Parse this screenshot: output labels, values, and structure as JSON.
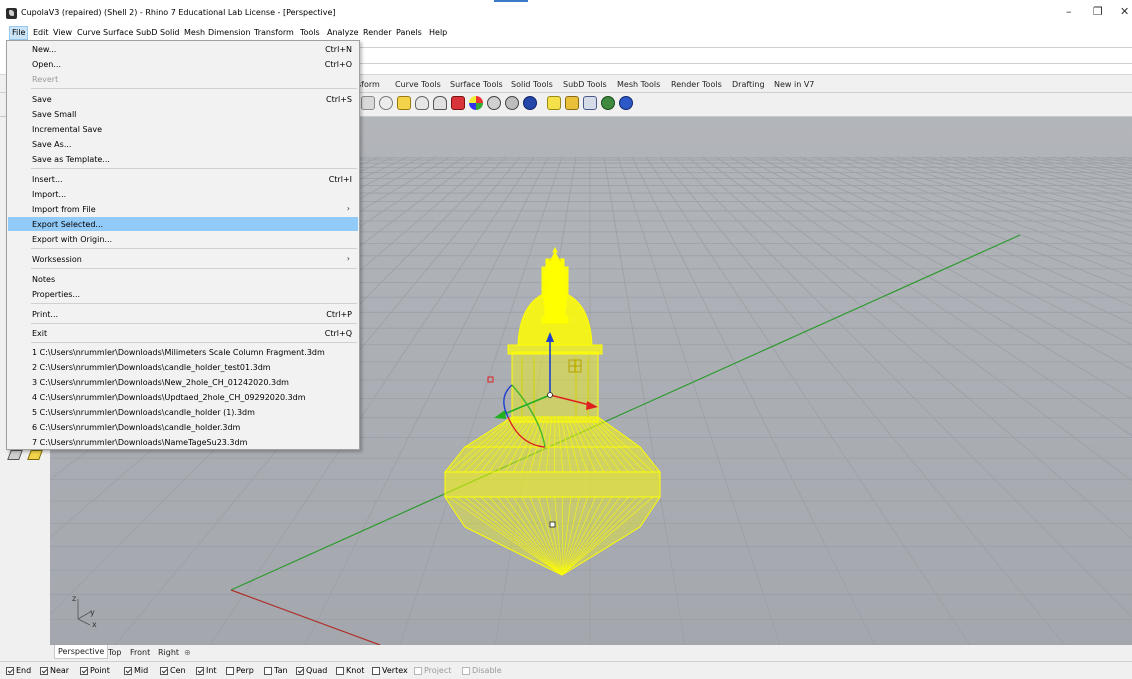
{
  "window": {
    "title": "CupolaV3 (repaired) (Shell 2) - Rhino 7 Educational Lab License - [Perspective]",
    "controls": {
      "minimize": "–",
      "restore": "❐",
      "close": "✕"
    }
  },
  "menubar": {
    "items": [
      "File",
      "Edit",
      "View",
      "Curve",
      "Surface",
      "SubD",
      "Solid",
      "Mesh",
      "Dimension",
      "Transform",
      "Tools",
      "Analyze",
      "Render",
      "Panels",
      "Help"
    ],
    "active": "File"
  },
  "toolbar_tabs": [
    "sform",
    "Curve Tools",
    "Surface Tools",
    "Solid Tools",
    "SubD Tools",
    "Mesh Tools",
    "Render Tools",
    "Drafting",
    "New in V7"
  ],
  "file_menu": {
    "items": [
      {
        "label": "New...",
        "shortcut": "Ctrl+N"
      },
      {
        "label": "Open...",
        "shortcut": "Ctrl+O"
      },
      {
        "label": "Revert",
        "shortcut": "",
        "disabled": true
      },
      {
        "label": "Save",
        "shortcut": "Ctrl+S"
      },
      {
        "label": "Save Small",
        "shortcut": ""
      },
      {
        "label": "Incremental Save",
        "shortcut": ""
      },
      {
        "label": "Save As...",
        "shortcut": ""
      },
      {
        "label": "Save as Template...",
        "shortcut": ""
      },
      {
        "label": "Insert...",
        "shortcut": "Ctrl+I"
      },
      {
        "label": "Import...",
        "shortcut": ""
      },
      {
        "label": "Import from File",
        "shortcut": "",
        "submenu": true
      },
      {
        "label": "Export Selected...",
        "shortcut": "",
        "highlighted": true
      },
      {
        "label": "Export with Origin...",
        "shortcut": ""
      },
      {
        "label": "Worksession",
        "shortcut": "",
        "submenu": true
      },
      {
        "label": "Notes",
        "shortcut": ""
      },
      {
        "label": "Properties...",
        "shortcut": ""
      },
      {
        "label": "Print...",
        "shortcut": "Ctrl+P"
      },
      {
        "label": "Exit",
        "shortcut": "Ctrl+Q"
      },
      {
        "label": "1 C:\\Users\\nrummler\\Downloads\\Milimeters Scale Column Fragment.3dm",
        "shortcut": ""
      },
      {
        "label": "2 C:\\Users\\nrummler\\Downloads\\candle_holder_test01.3dm",
        "shortcut": ""
      },
      {
        "label": "3 C:\\Users\\nrummler\\Downloads\\New_2hole_CH_01242020.3dm",
        "shortcut": ""
      },
      {
        "label": "4 C:\\Users\\nrummler\\Downloads\\Updtaed_2hole_CH_09292020.3dm",
        "shortcut": ""
      },
      {
        "label": "5 C:\\Users\\nrummler\\Downloads\\candle_holder (1).3dm",
        "shortcut": ""
      },
      {
        "label": "6 C:\\Users\\nrummler\\Downloads\\candle_holder.3dm",
        "shortcut": ""
      },
      {
        "label": "7 C:\\Users\\nrummler\\Downloads\\NameTageSu23.3dm",
        "shortcut": ""
      }
    ],
    "submenu_arrow": "›"
  },
  "viewport": {
    "axis_labels": {
      "z": "z",
      "y": "y",
      "x": "x"
    },
    "colors": {
      "background": "#a9adb3",
      "grid": "#9a9ea4",
      "x_axis": "#b0302a",
      "y_axis": "#2f9a2f",
      "object": "#ffff00",
      "gumball_z": "#1f3fd0",
      "gumball_x": "#e02020",
      "gumball_y": "#20b020"
    }
  },
  "viewport_tabs": {
    "items": [
      "Perspective",
      "Top",
      "Front",
      "Right"
    ],
    "active": "Perspective",
    "add_icon": "⊕"
  },
  "osnaps": [
    {
      "label": "End",
      "checked": true
    },
    {
      "label": "Near",
      "checked": true
    },
    {
      "label": "Point",
      "checked": true
    },
    {
      "label": "Mid",
      "checked": true
    },
    {
      "label": "Cen",
      "checked": true
    },
    {
      "label": "Int",
      "checked": true
    },
    {
      "label": "Perp",
      "checked": false
    },
    {
      "label": "Tan",
      "checked": false
    },
    {
      "label": "Quad",
      "checked": true
    },
    {
      "label": "Knot",
      "checked": false
    },
    {
      "label": "Vertex",
      "checked": false
    },
    {
      "label": "Project",
      "checked": false,
      "disabled": true
    },
    {
      "label": "Disable",
      "checked": false,
      "disabled": true
    }
  ]
}
